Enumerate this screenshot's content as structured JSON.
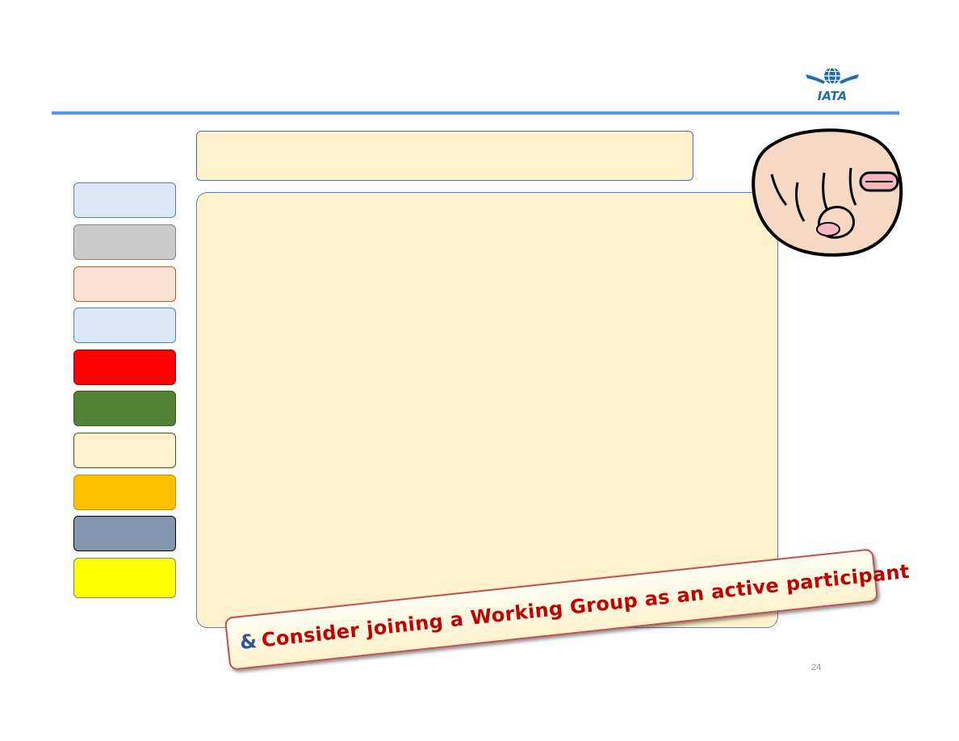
{
  "logo": {
    "text": "IATA"
  },
  "swatches": [
    {
      "color": "#dae8f7",
      "border": "#4f81bd"
    },
    {
      "color": "#cccccc",
      "border": "#7f7f7f"
    },
    {
      "color": "#fbe4d5",
      "border": "#c55a11"
    },
    {
      "color": "#dae8f7",
      "border": "#4f81bd"
    },
    {
      "color": "#ff0000",
      "border": "#9c0006"
    },
    {
      "color": "#548235",
      "border": "#385723"
    },
    {
      "color": "#fff2cc",
      "border": "#385723"
    },
    {
      "color": "#ffc000",
      "border": "#bf9000"
    },
    {
      "color": "#8497b0",
      "border": "#000000"
    },
    {
      "color": "#ffff00",
      "border": "#7f7f7f"
    }
  ],
  "banner": {
    "prefix": "&",
    "text": "Consider joining a Working Group as an active participant"
  },
  "page_number": "24"
}
